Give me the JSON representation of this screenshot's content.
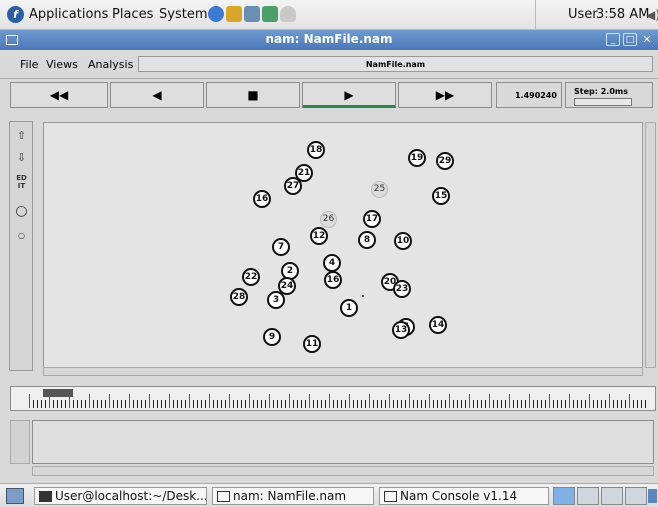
{
  "top_panel": {
    "menus": [
      "Applications",
      "Places",
      "System"
    ],
    "user": "User",
    "clock": "3:58 AM"
  },
  "window": {
    "title": "nam: NamFile.nam"
  },
  "menubar": {
    "file": "File",
    "views": "Views",
    "analysis": "Analysis",
    "file_label": "NamFile.nam"
  },
  "playback": {
    "rewind": "◀◀",
    "back": "◀",
    "stop": "■",
    "play": "▶",
    "fastforward": "▶▶",
    "time": "1.490240",
    "step_label": "Step: 2.0ms"
  },
  "tools": {
    "edit": "ED\nIT"
  },
  "nodes": [
    {
      "id": "18",
      "gray": false
    },
    {
      "id": "19",
      "gray": false
    },
    {
      "id": "29",
      "gray": false
    },
    {
      "id": "21",
      "gray": false
    },
    {
      "id": "27",
      "gray": false
    },
    {
      "id": "25",
      "gray": true
    },
    {
      "id": "15",
      "gray": false
    },
    {
      "id": "16",
      "gray": false
    },
    {
      "id": "17",
      "gray": false
    },
    {
      "id": "26",
      "gray": true
    },
    {
      "id": "12",
      "gray": false
    },
    {
      "id": "8",
      "gray": false
    },
    {
      "id": "10",
      "gray": false
    },
    {
      "id": "7",
      "gray": false
    },
    {
      "id": "4",
      "gray": false
    },
    {
      "id": "22",
      "gray": false
    },
    {
      "id": "2",
      "gray": false
    },
    {
      "id": "16",
      "gray": false
    },
    {
      "id": "20",
      "gray": false
    },
    {
      "id": "24",
      "gray": false
    },
    {
      "id": "23",
      "gray": false
    },
    {
      "id": "28",
      "gray": false
    },
    {
      "id": "3",
      "gray": false
    },
    {
      "id": "1",
      "gray": false
    },
    {
      "id": "5",
      "gray": false
    },
    {
      "id": "14",
      "gray": false
    },
    {
      "id": "9",
      "gray": false
    },
    {
      "id": "11",
      "gray": false
    },
    {
      "id": "13",
      "gray": false
    }
  ],
  "taskbar": {
    "tasks": [
      "User@localhost:~/Desk...",
      "nam: NamFile.nam",
      "Nam Console v1.14"
    ]
  }
}
